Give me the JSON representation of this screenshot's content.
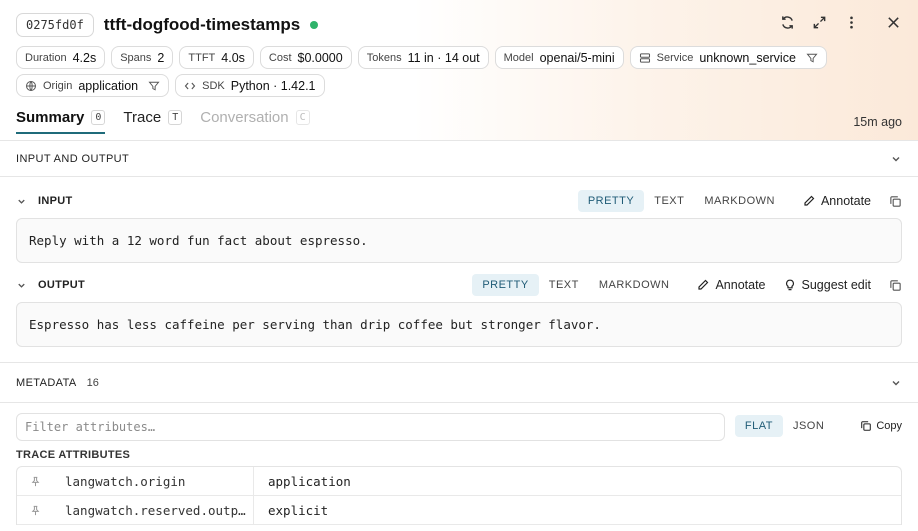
{
  "header": {
    "trace_id": "0275fd0f",
    "title": "ttft-dogfood-timestamps",
    "status_color": "#2fb36a"
  },
  "chips_row1": [
    {
      "label": "Duration",
      "value": "4.2s"
    },
    {
      "label": "Spans",
      "value": "2"
    },
    {
      "label": "TTFT",
      "value": "4.0s"
    },
    {
      "label": "Cost",
      "value": "$0.0000"
    },
    {
      "label": "Tokens",
      "value": "11 in · 14 out"
    },
    {
      "label": "Model",
      "value": "openai/5-mini"
    },
    {
      "label": "Service",
      "value": "unknown_service"
    }
  ],
  "chips_row2": [
    {
      "label": "Origin",
      "value": "application"
    },
    {
      "label": "SDK",
      "value": "Python · 1.42.1"
    }
  ],
  "tabs": [
    {
      "label": "Summary",
      "key": "0"
    },
    {
      "label": "Trace",
      "key": "T"
    },
    {
      "label": "Conversation",
      "key": "C"
    }
  ],
  "time_ago": "15m ago",
  "io_section": {
    "title": "INPUT AND OUTPUT"
  },
  "input": {
    "label": "INPUT",
    "formats": [
      "PRETTY",
      "TEXT",
      "MARKDOWN"
    ],
    "annotate": "Annotate",
    "content": "Reply with a 12 word fun fact about espresso."
  },
  "output": {
    "label": "OUTPUT",
    "formats": [
      "PRETTY",
      "TEXT",
      "MARKDOWN"
    ],
    "annotate": "Annotate",
    "suggest": "Suggest edit",
    "content": "Espresso has less caffeine per serving than drip coffee but stronger flavor."
  },
  "metadata": {
    "title": "METADATA",
    "count": "16",
    "filter_placeholder": "Filter attributes…",
    "views": [
      "FLAT",
      "JSON"
    ],
    "copy": "Copy",
    "attr_title": "TRACE ATTRIBUTES",
    "rows": [
      {
        "key": "langwatch.origin",
        "value": "application"
      },
      {
        "key": "langwatch.reserved.outp…",
        "value": "explicit"
      }
    ]
  },
  "colors": {
    "accent": "#1f6b7a",
    "pretty_bg": "#e6f1f6"
  }
}
